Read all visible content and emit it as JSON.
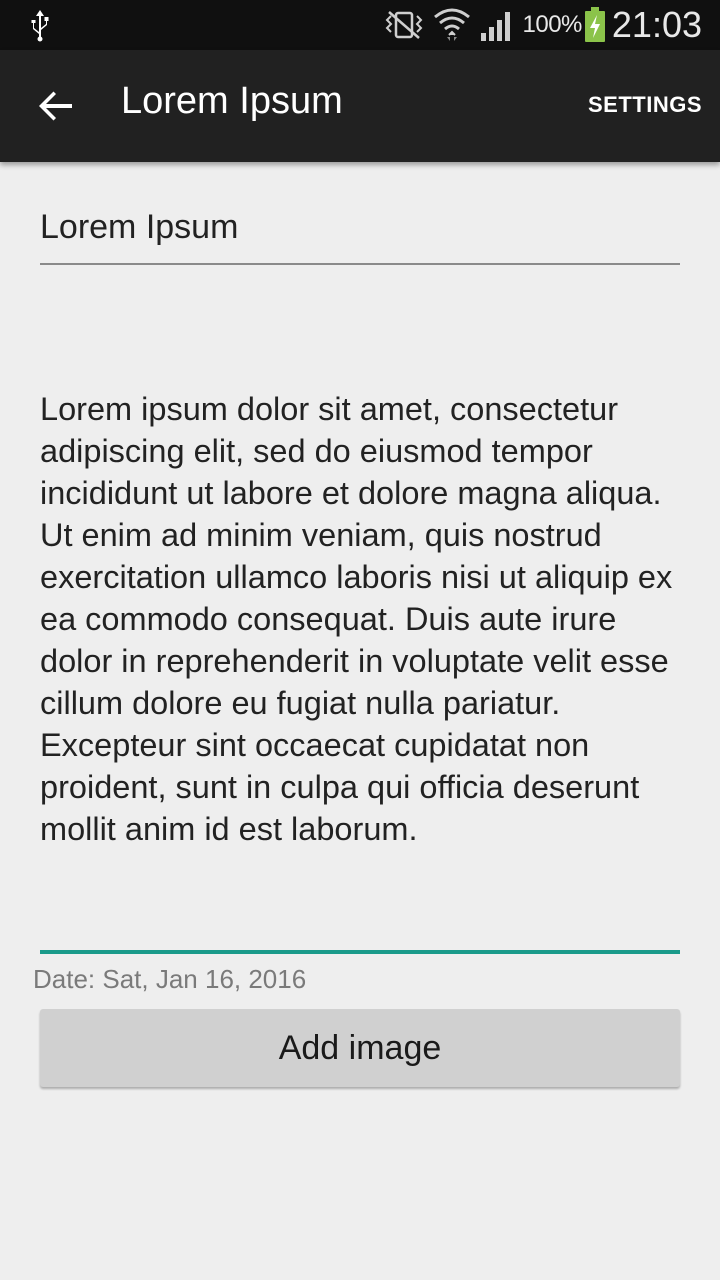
{
  "status_bar": {
    "battery_percent": "100%",
    "time": "21:03",
    "icons": [
      "usb-icon",
      "vibrate-icon",
      "wifi-icon",
      "signal-icon",
      "battery-charging-icon"
    ]
  },
  "app_bar": {
    "back_icon": "arrow-back-icon",
    "title": "Lorem Ipsum",
    "settings_label": "SETTINGS"
  },
  "form": {
    "title_value": "Lorem Ipsum",
    "body_value": "Lorem ipsum dolor sit amet, consectetur adipiscing elit, sed do eiusmod tempor incididunt ut labore et dolore magna aliqua. Ut enim ad minim veniam, quis nostrud exercitation ullamco laboris nisi ut aliquip ex ea commodo consequat. Duis aute irure dolor in reprehenderit in voluptate velit esse cillum dolore eu fugiat nulla pariatur. Excepteur sint occaecat cupidatat non proident, sunt in culpa qui officia deserunt mollit anim id est laborum.",
    "date_text": "Date: Sat, Jan 16, 2016",
    "add_image_label": "Add image"
  },
  "colors": {
    "status_bar_bg": "#101010",
    "app_bar_bg": "#212121",
    "page_bg": "#eeeeee",
    "accent": "#1a9a8a",
    "battery_green": "#8bc34a"
  }
}
